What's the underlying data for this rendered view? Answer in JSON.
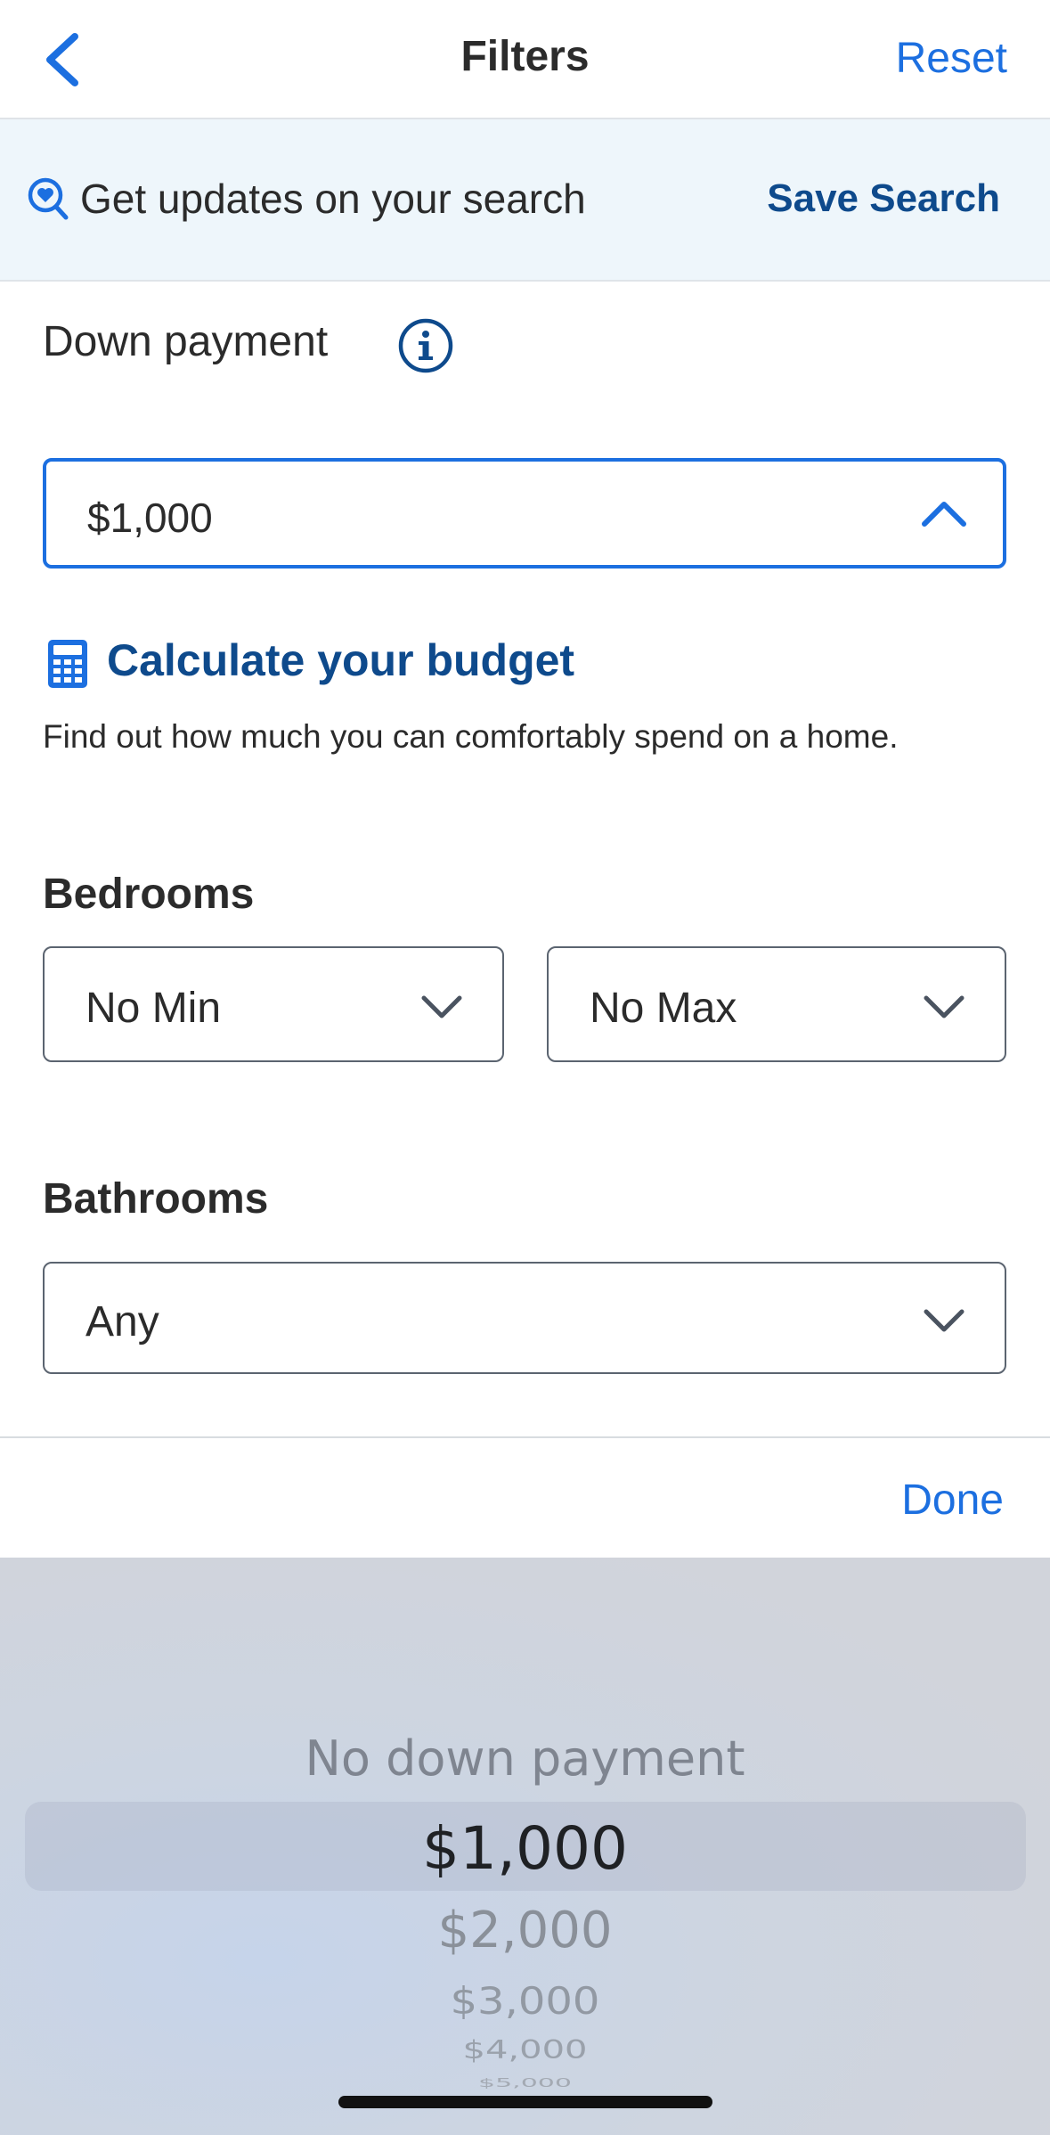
{
  "header": {
    "title": "Filters",
    "reset_label": "Reset"
  },
  "banner": {
    "text": "Get updates on your search",
    "save_label": "Save Search"
  },
  "down_payment": {
    "label": "Down payment",
    "selected_value": "$1,000"
  },
  "calculator": {
    "link_label": "Calculate your budget",
    "description": "Find out how much you can comfortably spend on a home."
  },
  "bedrooms": {
    "label": "Bedrooms",
    "min_value": "No Min",
    "max_value": "No Max"
  },
  "bathrooms": {
    "label": "Bathrooms",
    "value": "Any"
  },
  "toolbar": {
    "done_label": "Done"
  },
  "picker": {
    "options": [
      "No down payment",
      "$1,000",
      "$2,000",
      "$3,000",
      "$4,000",
      "$5,000"
    ],
    "selected_index": 1
  },
  "colors": {
    "accent": "#1c6fe0",
    "dark_blue": "#0e4a8c",
    "banner_bg": "#eef6fb"
  }
}
